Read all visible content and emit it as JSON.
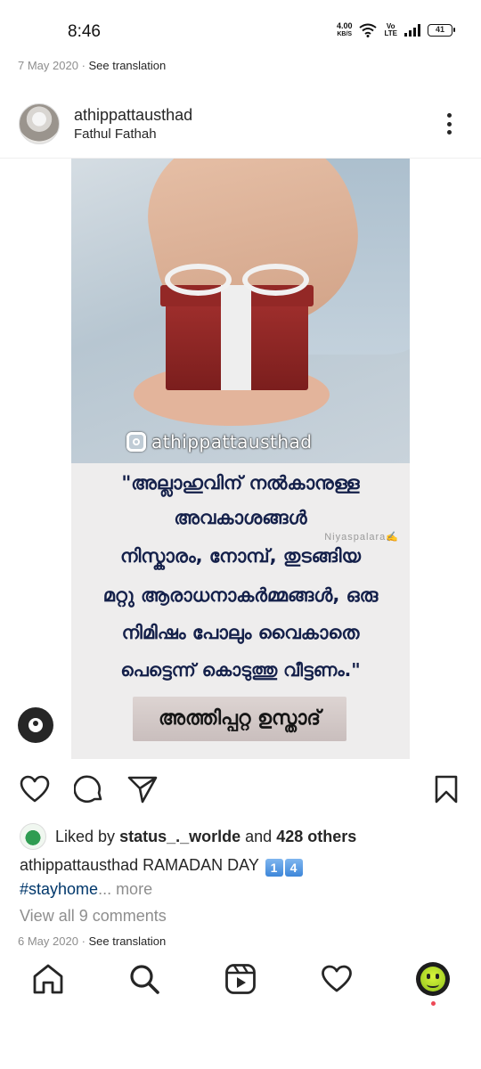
{
  "status_bar": {
    "time": "8:46",
    "net_speed_value": "4.00",
    "net_speed_unit": "KB/S",
    "volte_top": "Vo",
    "volte_bottom": "LTE",
    "battery": "41"
  },
  "post_date_top": "7 May 2020",
  "see_translation_top": "See translation",
  "post": {
    "username": "athippattausthad",
    "location": "Fathul Fathah",
    "image": {
      "watermark_handle": "athippattausthad",
      "credit": "Niyaspalara✍️",
      "quote_lines": [
        "\"അല്ലാഹുവിന് നൽകാനുള്ള",
        "അവകാശങ്ങൾ",
        "നിസ്കാരം, നോമ്പ്, തുടങ്ങിയ",
        "മറ്റു ആരാധനാകർമ്മങ്ങൾ, ഒരു",
        "നിമിഷം പോലും വൈകാതെ",
        "പെട്ടെന്ന് കൊടുത്തു വീട്ടണം.\""
      ],
      "author": "അത്തിപ്പറ്റ ഉസ്താദ്"
    },
    "liked_by_prefix": "Liked by",
    "liked_by_user": "status_._worlde",
    "liked_by_and": "and",
    "liked_by_others": "428 others",
    "caption_user": "athippattausthad",
    "caption_text": "RAMADAN DAY",
    "caption_emoji_1": "1",
    "caption_emoji_2": "4",
    "hashtag": "#stayhome",
    "more": "... more",
    "view_comments": "View all 9 comments",
    "date": "6 May 2020",
    "see_translation": "See translation"
  },
  "colors": {
    "text": "#262626",
    "muted": "#8e8e8e",
    "hashtag": "#00376b",
    "notification": "#ed4956",
    "quote_text": "#14204a"
  },
  "icons": [
    "heart-icon",
    "comment-icon",
    "share-icon",
    "bookmark-icon",
    "home-icon",
    "search-icon",
    "reels-icon",
    "activity-icon",
    "more-options-icon",
    "tag-people-icon"
  ]
}
